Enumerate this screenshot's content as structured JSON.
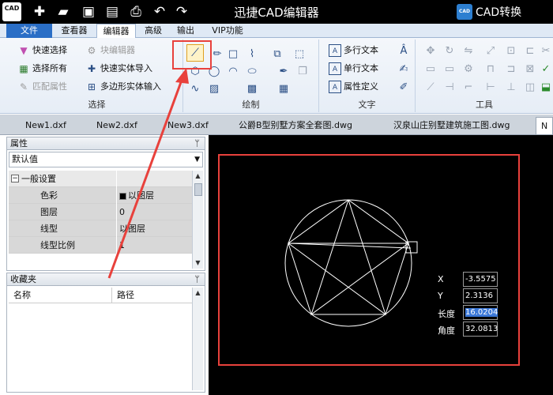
{
  "app": {
    "logo_text": "CAD",
    "title": "迅捷CAD编辑器",
    "convert_icon_text": "CAD",
    "convert_label": "CAD转换"
  },
  "menu": {
    "tabs": [
      "文件",
      "查看器",
      "编辑器",
      "高级",
      "输出",
      "VIP功能"
    ],
    "active": "编辑器"
  },
  "ribbon": {
    "select_group": {
      "label": "选择",
      "items": [
        "快速选择",
        "选择所有",
        "匹配属性",
        "块编辑器",
        "快速实体导入",
        "多边形实体输入"
      ]
    },
    "draw_group": {
      "label": "绘制"
    },
    "text_group": {
      "label": "文字",
      "items": [
        "多行文本",
        "单行文本",
        "属性定义"
      ]
    },
    "tools_group": {
      "label": "工具"
    }
  },
  "doc_tabs": [
    "New1.dxf",
    "New2.dxf",
    "New3.dxf",
    "公爵B型别墅方案全套图.dwg",
    "汉泉山庄别墅建筑施工图.dwg",
    "N"
  ],
  "properties": {
    "header": "属性",
    "pin": "ᛘ",
    "dropdown_value": "默认值",
    "group": "一般设置",
    "rows": [
      {
        "key": "色彩",
        "value": "以图层"
      },
      {
        "key": "图层",
        "value": "0"
      },
      {
        "key": "线型",
        "value": "以图层"
      },
      {
        "key": "线型比例",
        "value": "1"
      }
    ]
  },
  "favorites": {
    "header": "收藏夹",
    "pin": "ᛘ",
    "col_name": "名称",
    "col_path": "路径"
  },
  "coords": {
    "x_label": "X",
    "x_value": "-3.5575",
    "y_label": "Y",
    "y_value": "2.3136",
    "len_label": "长度",
    "len_value": "16.0204",
    "ang_label": "角度",
    "ang_value": "32.0813"
  },
  "colors": {
    "accent_red": "#e8413c",
    "file_tab_blue": "#2a6ec6",
    "canvas": "#000000"
  }
}
